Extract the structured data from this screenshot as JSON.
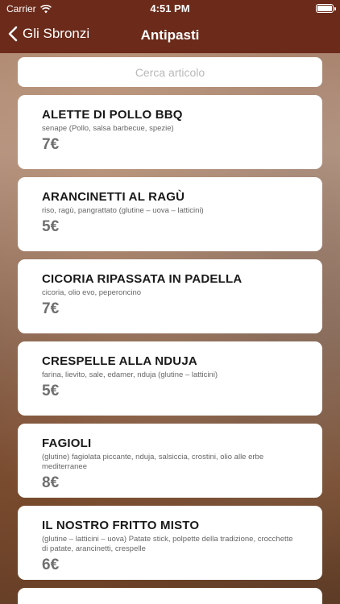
{
  "status": {
    "carrier": "Carrier",
    "time": "4:51 PM"
  },
  "nav": {
    "back_label": "Gli Sbronzi",
    "title": "Antipasti"
  },
  "search": {
    "placeholder": "Cerca articolo"
  },
  "items": [
    {
      "name": "ALETTE DI POLLO BBQ",
      "description": "senape (Pollo, salsa barbecue, spezie)",
      "price": "7€"
    },
    {
      "name": "ARANCINETTI AL RAGÙ",
      "description": "riso, ragù, pangrattato (glutine – uova – latticini)",
      "price": "5€"
    },
    {
      "name": "CICORIA RIPASSATA IN PADELLA",
      "description": "cicoria, olio evo, peperoncino",
      "price": "7€"
    },
    {
      "name": "CRESPELLE ALLA NDUJA",
      "description": "farina, lievito, sale, edamer, nduja (glutine – latticini)",
      "price": "5€"
    },
    {
      "name": "FAGIOLI",
      "description": "(glutine) fagiolata piccante, nduja, salsiccia, crostini, olio alle erbe mediterranee",
      "price": "8€"
    },
    {
      "name": "IL NOSTRO FRITTO MISTO",
      "description": "(glutine – latticini – uova) Patate stick, polpette della tradizione, crocchette di patate, arancinetti, crespelle",
      "price": "6€"
    }
  ],
  "colors": {
    "navbar": "#6b2a1a",
    "card": "#ffffff",
    "price": "#6f6f6f"
  },
  "icons": {
    "back": "chevron-left-icon",
    "wifi": "wifi-icon",
    "battery": "battery-icon"
  }
}
